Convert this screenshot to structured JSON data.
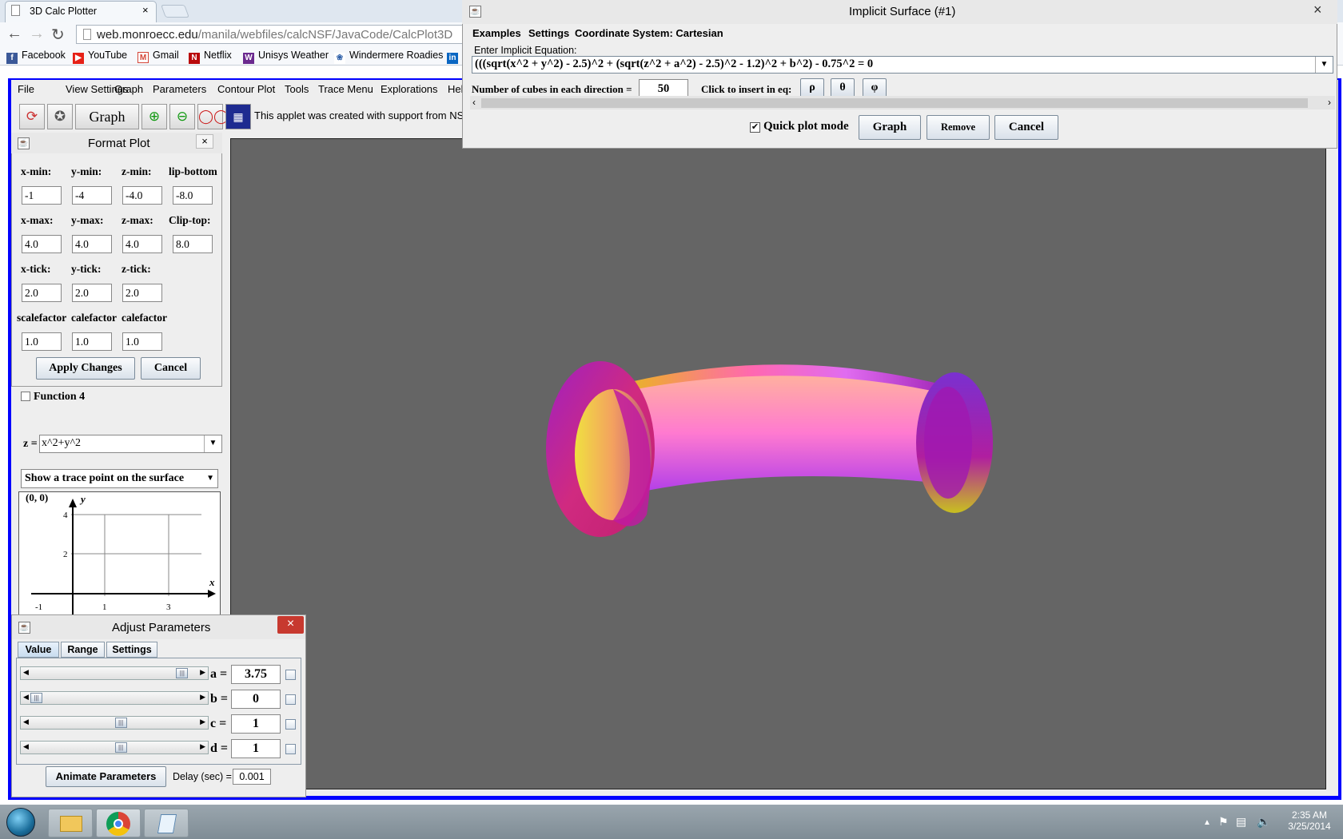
{
  "browser": {
    "tab_title": "3D Calc Plotter",
    "tab_close": "×",
    "url_host": "web.monroecc.edu",
    "url_path": "/manila/webfiles/calcNSF/JavaCode/CalcPlot3D",
    "bookmarks": [
      "Facebook",
      "YouTube",
      "Gmail",
      "Netflix",
      "Unisys Weather",
      "Windermere Roadies"
    ],
    "bookmark_colors": [
      "#3b5998",
      "#e62117",
      "#d44638",
      "#b9090b",
      "#6b2a8f",
      "#2d5fa8"
    ]
  },
  "applet": {
    "menu": [
      "File",
      "View Settings",
      "Graph",
      "Parameters",
      "Contour Plot",
      "Tools",
      "Trace Menu",
      "Explorations",
      "Hel"
    ],
    "toolbar_graph_label": "Graph",
    "support_text": "This applet was created with support from NSF"
  },
  "format_plot": {
    "title": "Format Plot",
    "close": "×",
    "labels_row1": [
      "x-min:",
      "y-min:",
      "z-min:",
      "lip-bottom"
    ],
    "values_row1": [
      "-1",
      "-4",
      "-4.0",
      "-8.0"
    ],
    "labels_row2": [
      "x-max:",
      "y-max:",
      "z-max:",
      "Clip-top:"
    ],
    "values_row2": [
      "4.0",
      "4.0",
      "4.0",
      "8.0"
    ],
    "labels_row3": [
      "x-tick:",
      "y-tick:",
      "z-tick:"
    ],
    "values_row3": [
      "2.0",
      "2.0",
      "2.0"
    ],
    "labels_row4": [
      "scalefactor",
      "calefactor",
      "calefactor"
    ],
    "values_row4": [
      "1.0",
      "1.0",
      "1.0"
    ],
    "apply_label": "Apply Changes",
    "cancel_label": "Cancel"
  },
  "left_panel": {
    "function_label": "Function 4",
    "z_prefix": "z =",
    "z_value": "x^2+y^2",
    "trace_option": "Show a trace point on the surface",
    "trace_coord": "(0, 0)",
    "axis_x": "x",
    "axis_y": "y",
    "y_ticks": [
      "4",
      "2"
    ],
    "x_ticks": [
      "-1",
      "1",
      "3"
    ]
  },
  "adjust": {
    "title": "Adjust Parameters",
    "close": "×",
    "tabs": [
      "Value",
      "Range",
      "Settings"
    ],
    "params": [
      {
        "name": "a =",
        "value": "3.75",
        "level": 0.95
      },
      {
        "name": "b =",
        "value": "0",
        "level": 0.0
      },
      {
        "name": "c =",
        "value": "1",
        "level": 0.55
      },
      {
        "name": "d =",
        "value": "1",
        "level": 0.55
      }
    ],
    "animate_label": "Animate Parameters",
    "delay_label": "Delay (sec) =",
    "delay_value": "0.001"
  },
  "implicit": {
    "title": "Implicit Surface (#1)",
    "close": "×",
    "menu": [
      "Examples",
      "Settings",
      "Coordinate System: Cartesian"
    ],
    "prompt": "Enter Implicit Equation:",
    "equation": "(((sqrt(x^2 + y^2) - 2.5)^2 + (sqrt(z^2 + a^2) - 2.5)^2 - 1.2)^2 + b^2) - 0.75^2 = 0",
    "cubes_label": "Number of cubes in each direction =",
    "cubes_value": "50",
    "insert_label": "Click to insert in eq:",
    "insert_symbols": [
      "ρ",
      "θ",
      "φ"
    ],
    "quick_plot_label": "Quick plot mode",
    "graph_label": "Graph",
    "remove_label": "Remove",
    "cancel_label": "Cancel"
  },
  "taskbar": {
    "time": "2:35 AM",
    "date": "3/25/2014"
  },
  "colors": {
    "applet_border": "#0000ff",
    "plot_background": "#656565"
  }
}
